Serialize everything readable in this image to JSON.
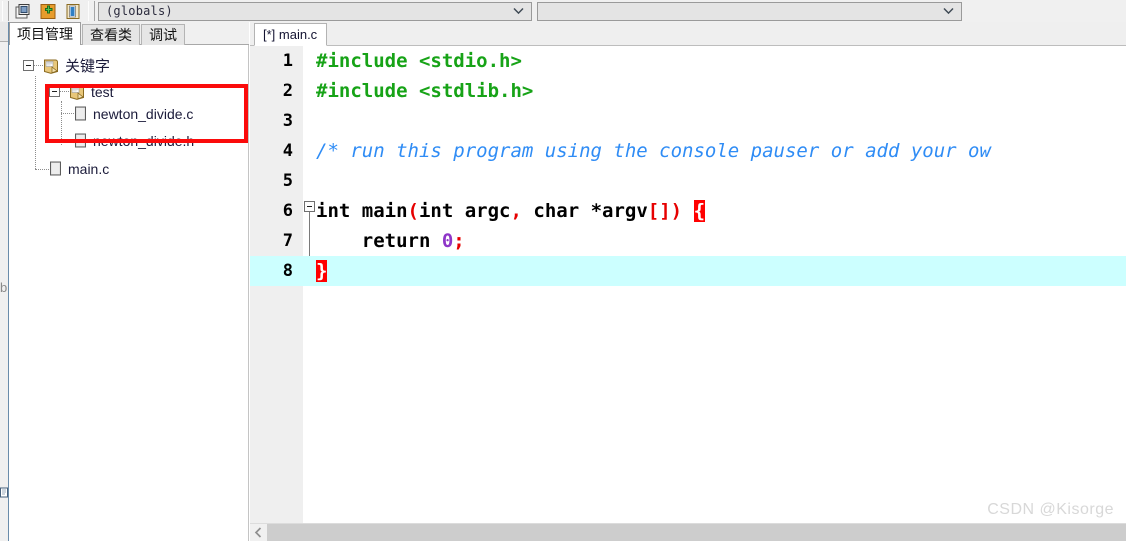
{
  "toolbar": {
    "buttons": [
      {
        "name": "new-project-icon",
        "title": "New"
      },
      {
        "name": "add-to-project-icon",
        "title": "Add"
      },
      {
        "name": "remove-from-project-icon",
        "title": "Remove"
      }
    ],
    "class_combo": {
      "value": "(globals)",
      "placeholder": ""
    },
    "member_combo": {
      "value": "",
      "placeholder": ""
    }
  },
  "panel": {
    "tabs": [
      {
        "label": "项目管理",
        "active": true
      },
      {
        "label": "查看类",
        "active": false
      },
      {
        "label": "调试",
        "active": false
      }
    ],
    "tree": [
      {
        "label": "关键字",
        "icon": "project-icon",
        "level": 0,
        "expanded": true
      },
      {
        "label": "test",
        "icon": "project-icon",
        "level": 1,
        "expanded": true
      },
      {
        "label": "newton_divide.c",
        "icon": "file-icon",
        "level": 2
      },
      {
        "label": "newton_divide.h",
        "icon": "file-icon",
        "level": 2
      },
      {
        "label": "main.c",
        "icon": "file-icon",
        "level": 1
      }
    ],
    "annotation": {
      "color": "#fb0b0b",
      "shape": "rectangle"
    }
  },
  "editor": {
    "tabs": [
      {
        "label": "[*] main.c",
        "active": true,
        "modified": true
      }
    ],
    "lines": [
      {
        "num": "1",
        "tokens": [
          {
            "t": "#include <stdio.h>",
            "c": "prep"
          }
        ]
      },
      {
        "num": "2",
        "tokens": [
          {
            "t": "#include <stdlib.h>",
            "c": "prep"
          }
        ]
      },
      {
        "num": "3",
        "tokens": []
      },
      {
        "num": "4",
        "tokens": [
          {
            "t": "/* run this program using the console pauser or add your ow",
            "c": "cmt"
          }
        ]
      },
      {
        "num": "5",
        "tokens": []
      },
      {
        "num": "6",
        "fold": "start",
        "tokens": [
          {
            "t": "int main",
            "c": "kw"
          },
          {
            "t": "(",
            "c": "red"
          },
          {
            "t": "int argc",
            "c": "kw"
          },
          {
            "t": ", ",
            "c": "red"
          },
          {
            "t": "char ",
            "c": "kw"
          },
          {
            "t": "*",
            "c": "kw"
          },
          {
            "t": "argv",
            "c": "kw"
          },
          {
            "t": "[])",
            "c": "red"
          },
          {
            "t": " ",
            "c": "kw"
          },
          {
            "t": "{",
            "c": "brace-hl"
          }
        ]
      },
      {
        "num": "7",
        "fold": "mid",
        "tokens": [
          {
            "t": "    return ",
            "c": "kw"
          },
          {
            "t": "0",
            "c": "num"
          },
          {
            "t": ";",
            "c": "red"
          }
        ]
      },
      {
        "num": "8",
        "fold": "end",
        "current": true,
        "tokens": [
          {
            "t": "}",
            "c": "brace-hl"
          }
        ]
      }
    ],
    "scrollbar": {
      "left_arrow": "‹",
      "thumb_visible": true
    }
  },
  "watermark": {
    "text": "CSDN @Kisorge"
  },
  "colors": {
    "current_line": "#ccffff",
    "brace_highlight": "#ff0000",
    "comment": "#2f8cf5",
    "preprocessor": "#17a317",
    "symbol": "#e60000",
    "number": "#8e36c8",
    "annotation": "#fb0b0b"
  }
}
